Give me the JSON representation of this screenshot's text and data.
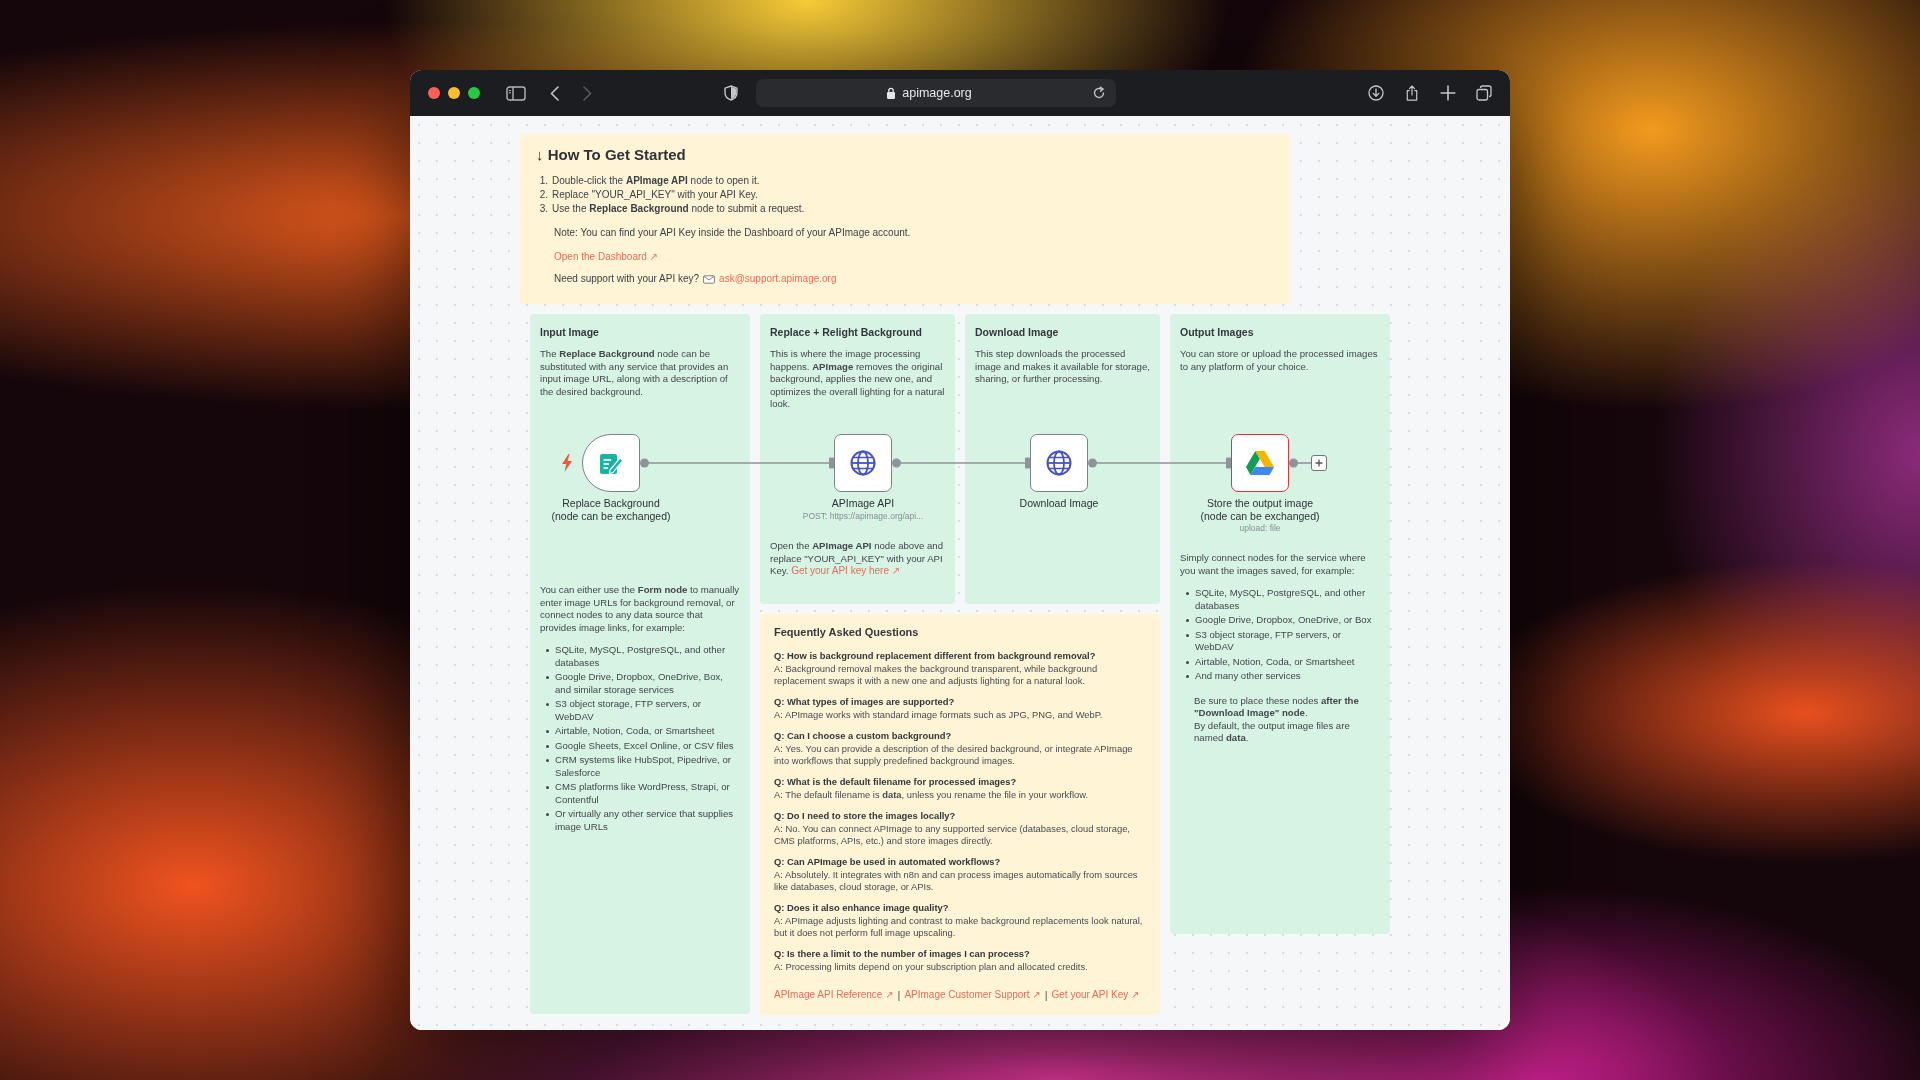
{
  "browser": {
    "url": "apimage.org",
    "back_disabled": false,
    "forward_disabled": true
  },
  "notes": [
    {
      "kind": "intro",
      "color": "#fff4d6",
      "title": "↓ How To Get Started",
      "steps": [
        {
          "number": "1.",
          "text": "Double-click the **APImage API** node to open it."
        },
        {
          "number": "2.",
          "text": "Replace \"YOUR_API_KEY\" with your API Key."
        },
        {
          "number": "3.",
          "text": "Use the **Replace Background** node to submit a request."
        }
      ],
      "note": "Note: You can find your API Key inside the Dashboard of your APImage account.",
      "link": "Open the Dashboard ↗",
      "support_text": "Need support with your API key?",
      "support_email": "ask@support.apimage.org"
    },
    {
      "kind": "column",
      "color": "#d6f3e4",
      "title": "Input Image",
      "intro": "The **Replace Background** node can be substituted with any service that provides an input image URL, along with a description of the desired background.",
      "details": "You can either use the **Form node** to manually enter image URLs for background removal, or connect nodes to any data source that provides image links, for example:",
      "bullets": [
        "SQLite, MySQL, PostgreSQL, and other databases",
        "Google Drive, Dropbox, OneDrive, Box, and similar storage services",
        "S3 object storage, FTP servers, or WebDAV",
        "Airtable, Notion, Coda, or Smartsheet",
        "Google Sheets, Excel Online, or CSV files",
        "CRM systems like HubSpot, Pipedrive, or Salesforce",
        "CMS platforms like WordPress, Strapi, or Contentful",
        "Or virtually any other service that supplies image URLs"
      ]
    },
    {
      "kind": "column",
      "color": "#d6f3e4",
      "title": "Replace + Relight Background",
      "intro": "This is where the image processing happens. **APImage** removes the original background, applies the new one, and optimizes the overall lighting for a natural look.",
      "details": "Open the **APImage API** node above and replace \"YOUR_API_KEY\" with your API Key.",
      "details_link": "Get your API key here ↗"
    },
    {
      "kind": "column",
      "color": "#d6f3e4",
      "title": "Download Image",
      "intro": "This step downloads the processed image and makes it available for storage, sharing, or further processing."
    },
    {
      "kind": "column",
      "color": "#d6f3e4",
      "title": "Output Images",
      "intro": "You can store or upload the processed images to any platform of your choice.",
      "details": "Simply connect nodes for the service where you want the images saved, for example:",
      "bullets": [
        "SQLite, MySQL, PostgreSQL, and other databases",
        "Google Drive, Dropbox, OneDrive, or Box",
        "S3 object storage, FTP servers, or WebDAV",
        "Airtable, Notion, Coda, or Smartsheet",
        "And many other services"
      ],
      "footer": [
        "Be sure to place these nodes **after the \"Download Image\" node**.",
        "By default, the output image files are named **data**."
      ]
    },
    {
      "kind": "faq",
      "color": "#fff4d6",
      "title": "Fequently Asked Questions",
      "items": [
        {
          "q": "Q: How is background replacement different from background removal?",
          "a": "A: Background removal makes the background transparent, while background replacement swaps it with a new one and adjusts lighting for a natural look."
        },
        {
          "q": "Q: What types of images are supported?",
          "a": "A: APImage works with standard image formats such as JPG, PNG, and WebP."
        },
        {
          "q": "Q: Can I choose a custom background?",
          "a": "A: Yes. You can provide a description of the desired background, or integrate APImage into workflows that supply predefined background images."
        },
        {
          "q": "Q: What is the default filename for processed images?",
          "a": "A: The default filename is **data**, unless you rename the file in your workflow."
        },
        {
          "q": "Q: Do I need to store the images locally?",
          "a": "A: No. You can connect APImage to any supported service (databases, cloud storage, CMS platforms, APIs, etc.) and store images directly."
        },
        {
          "q": "Q: Can APImage be used in automated workflows?",
          "a": "A: Absolutely. It integrates with n8n and can process images automatically from sources like databases, cloud storage, or APIs."
        },
        {
          "q": "Q: Does it also enhance image quality?",
          "a": "A: APImage adjusts lighting and contrast to make background replacements look natural, but it does not perform full image upscaling."
        },
        {
          "q": "Q: Is there a limit to the number of images I can process?",
          "a": "A: Processing limits depend on your subscription plan and allocated credits."
        }
      ],
      "links": [
        "APImage API Reference ↗",
        "APImage Customer Support ↗",
        "Get your API Key ↗"
      ],
      "link_separator": "|"
    }
  ],
  "workflow": {
    "nodes": [
      {
        "kind": "form_trigger",
        "label_lines": [
          "Replace Background",
          "(node can be exchanged)"
        ],
        "has_issue": false
      },
      {
        "kind": "http_request",
        "label_lines": [
          "APImage API"
        ],
        "subtitle": "POST: https://apimage.org/api...",
        "has_issue": false
      },
      {
        "kind": "http_request",
        "label_lines": [
          "Download Image"
        ],
        "has_issue": false
      },
      {
        "kind": "google_drive",
        "label_lines": [
          "Store the output image",
          "(node can be exchanged)"
        ],
        "subtitle": "upload: file",
        "has_issue": true
      }
    ]
  }
}
